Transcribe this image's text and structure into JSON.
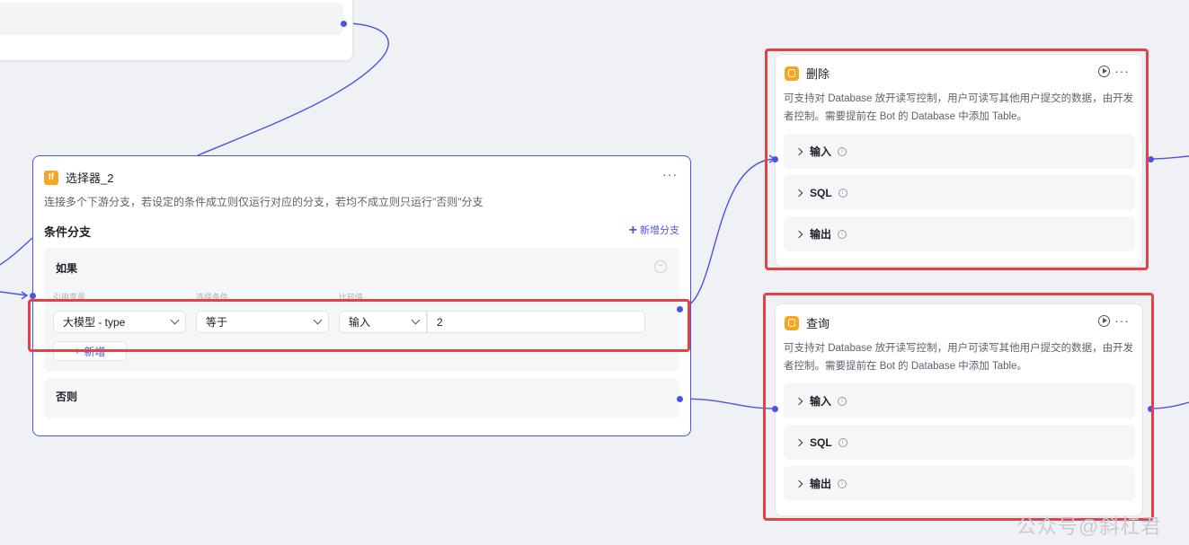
{
  "selector": {
    "icon_text": "If",
    "title": "选择器_2",
    "more": "···",
    "description": "连接多个下游分支，若设定的条件成立则仅运行对应的分支，若均不成立则只运行\"否则\"分支",
    "branch_section_title": "条件分支",
    "add_branch_label": "新增分支",
    "if_panel": {
      "title": "如果",
      "column_labels": [
        "引用变量",
        "选择条件",
        "比较值"
      ],
      "variable_value": "大模型 - type",
      "condition_value": "等于",
      "compare_type": "输入",
      "compare_value": "2",
      "add_label": "新增"
    },
    "else_panel": {
      "title": "否则"
    }
  },
  "delete_node": {
    "title": "删除",
    "description": "可支持对 Database 放开读写控制，用户可读写其他用户提交的数据，由开发者控制。需要提前在 Bot 的 Database 中添加 Table。",
    "more": "···",
    "sections": [
      "输入",
      "SQL",
      "输出"
    ]
  },
  "query_node": {
    "title": "查询",
    "description": "可支持对 Database 放开读写控制，用户可读写其他用户提交的数据，由开发者控制。需要提前在 Bot 的 Database 中添加 Table。",
    "more": "···",
    "sections": [
      "输入",
      "SQL",
      "输出"
    ]
  },
  "watermark": "公众号@斜杠君",
  "colors": {
    "accent": "#4d53e8",
    "highlight": "#e04246",
    "node_icon": "#f5a623"
  }
}
